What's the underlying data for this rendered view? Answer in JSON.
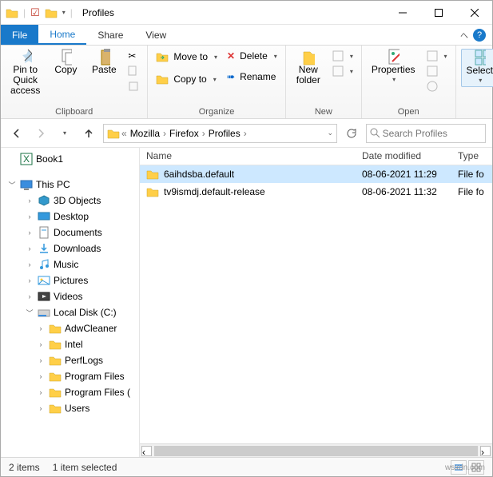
{
  "window": {
    "title": "Profiles"
  },
  "tabs": {
    "file": "File",
    "home": "Home",
    "share": "Share",
    "view": "View"
  },
  "ribbon": {
    "clipboard": {
      "label": "Clipboard",
      "pin": "Pin to Quick access",
      "copy": "Copy",
      "paste": "Paste",
      "cut": ""
    },
    "organize": {
      "label": "Organize",
      "moveto": "Move to",
      "copyto": "Copy to",
      "delete": "Delete",
      "rename": "Rename"
    },
    "new": {
      "label": "New",
      "newfolder": "New folder"
    },
    "open": {
      "label": "Open",
      "properties": "Properties"
    },
    "select": {
      "label": "",
      "select": "Select"
    }
  },
  "breadcrumbs": [
    "Mozilla",
    "Firefox",
    "Profiles"
  ],
  "search": {
    "placeholder": "Search Profiles"
  },
  "nav": {
    "book1": "Book1",
    "thispc": "This PC",
    "items": [
      "3D Objects",
      "Desktop",
      "Documents",
      "Downloads",
      "Music",
      "Pictures",
      "Videos"
    ],
    "disk": "Local Disk (C:)",
    "folders": [
      "AdwCleaner",
      "Intel",
      "PerfLogs",
      "Program Files",
      "Program Files (",
      "Users"
    ]
  },
  "columns": {
    "name": "Name",
    "date": "Date modified",
    "type": "Type"
  },
  "files": [
    {
      "name": "6aihdsba.default",
      "date": "08-06-2021 11:29",
      "type": "File fo",
      "selected": true
    },
    {
      "name": "tv9ismdj.default-release",
      "date": "08-06-2021 11:32",
      "type": "File fo",
      "selected": false
    }
  ],
  "status": {
    "count": "2 items",
    "selected": "1 item selected"
  },
  "watermark": "wsxdn.com"
}
